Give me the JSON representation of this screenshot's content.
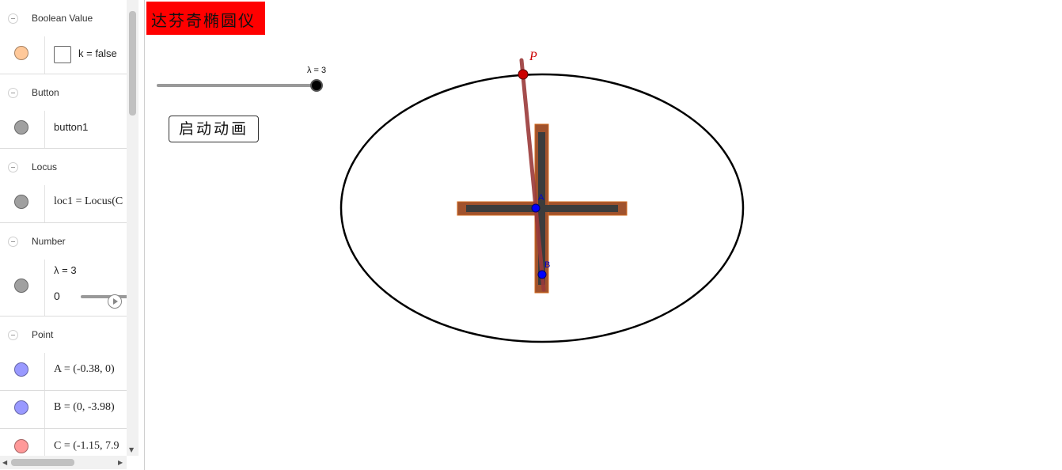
{
  "algebra": {
    "groups": {
      "boolean": "Boolean Value",
      "button": "Button",
      "locus": "Locus",
      "number": "Number",
      "point": "Point"
    },
    "items": {
      "k": {
        "text": "k = false",
        "color": "#ffc899"
      },
      "button1": {
        "text": "button1",
        "color": "#a0a0a0"
      },
      "loc1": {
        "text": "loc1 = Locus(C",
        "color": "#a0a0a0"
      },
      "lambda": {
        "text": "λ = 3",
        "slider_min": "0",
        "color": "#a0a0a0"
      },
      "A": {
        "text": "A = (-0.38, 0)",
        "color": "#9999ff"
      },
      "B": {
        "text": "B = (0, -3.98)",
        "color": "#9999ff"
      },
      "C": {
        "text": "C = (-1.15, 7.9",
        "color": "#ff9999"
      }
    }
  },
  "graphics": {
    "title": "达芬奇椭圆仪",
    "title_bg": "#ff0000",
    "start_button": "启动动画",
    "lambda_slider": {
      "label": "λ = 3",
      "value": 3,
      "fraction": 1.0
    },
    "point_labels": {
      "P": "P",
      "A": "A",
      "B": "B"
    },
    "colors": {
      "rail_fill": "#a0522d",
      "rail_slot": "#3c3c3c",
      "rod": "#9b3a3a",
      "point_blue": "#0000ff",
      "point_red": "#cc0000"
    }
  }
}
